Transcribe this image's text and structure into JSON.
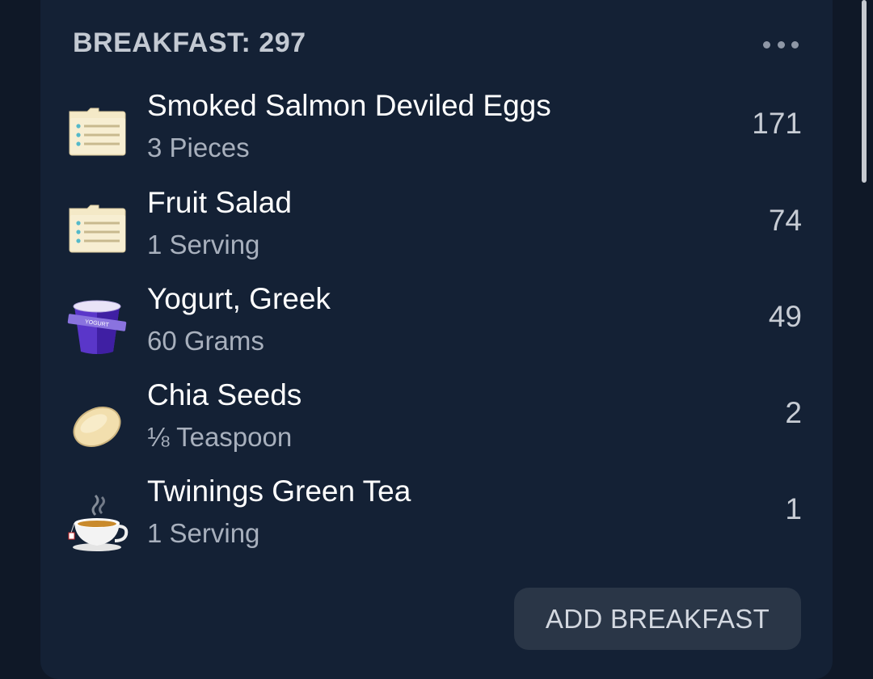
{
  "meal": {
    "header": "BREAKFAST: 297",
    "add_button_label": "ADD BREAKFAST"
  },
  "items": [
    {
      "name": "Smoked Salmon Deviled Eggs",
      "quantity": "3 Pieces",
      "calories": "171",
      "icon": "recipe-card-icon"
    },
    {
      "name": "Fruit Salad",
      "quantity": "1 Serving",
      "calories": "74",
      "icon": "recipe-card-icon"
    },
    {
      "name": "Yogurt, Greek",
      "quantity": "60 Grams",
      "calories": "49",
      "icon": "yogurt-cup-icon",
      "icon_text": "YOGURT"
    },
    {
      "name": "Chia Seeds",
      "quantity": "⅛ Teaspoon",
      "calories": "2",
      "icon": "seed-icon"
    },
    {
      "name": "Twinings Green Tea",
      "quantity": "1 Serving",
      "calories": "1",
      "icon": "tea-cup-icon"
    }
  ]
}
